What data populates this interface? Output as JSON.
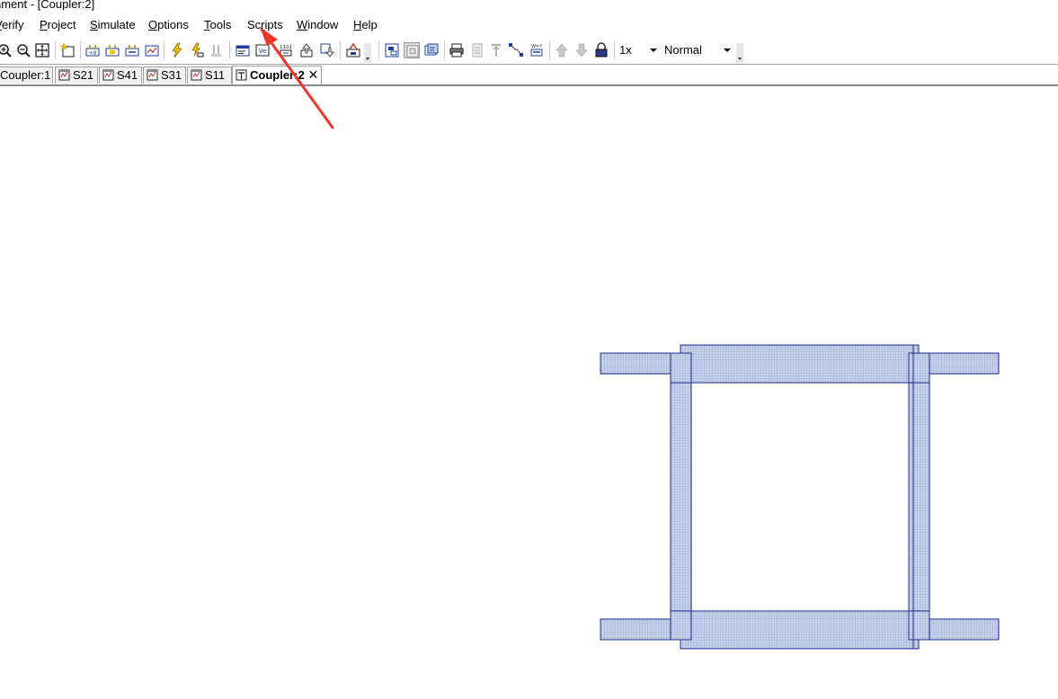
{
  "window": {
    "title": "nment - [Coupler:2]"
  },
  "menu": {
    "items": [
      {
        "pre": "",
        "acc": "V",
        "post": "erify"
      },
      {
        "pre": "",
        "acc": "P",
        "post": "roject"
      },
      {
        "pre": "",
        "acc": "S",
        "post": "imulate"
      },
      {
        "pre": "",
        "acc": "O",
        "post": "ptions"
      },
      {
        "pre": "",
        "acc": "T",
        "post": "ools"
      },
      {
        "pre": "Sc",
        "acc": "r",
        "post": "ipts"
      },
      {
        "pre": "",
        "acc": "W",
        "post": "indow"
      },
      {
        "pre": "",
        "acc": "H",
        "post": "elp"
      }
    ]
  },
  "toolbar": {
    "speed_value": "1x",
    "mode_value": "Normal"
  },
  "tabs": [
    {
      "label": "Coupler:1"
    },
    {
      "label": "S21"
    },
    {
      "label": "S41"
    },
    {
      "label": "S31"
    },
    {
      "label": "S11"
    },
    {
      "label": "Coupler:2"
    }
  ],
  "icons": {
    "tab_graph": "graph-icon",
    "tab_schematic": "schematic-icon",
    "close": "close-icon"
  },
  "colors": {
    "layout_stroke": "#1c2d8c",
    "layout_fill": "#c9d3ea",
    "annotation_arrow": "#f0352a"
  }
}
